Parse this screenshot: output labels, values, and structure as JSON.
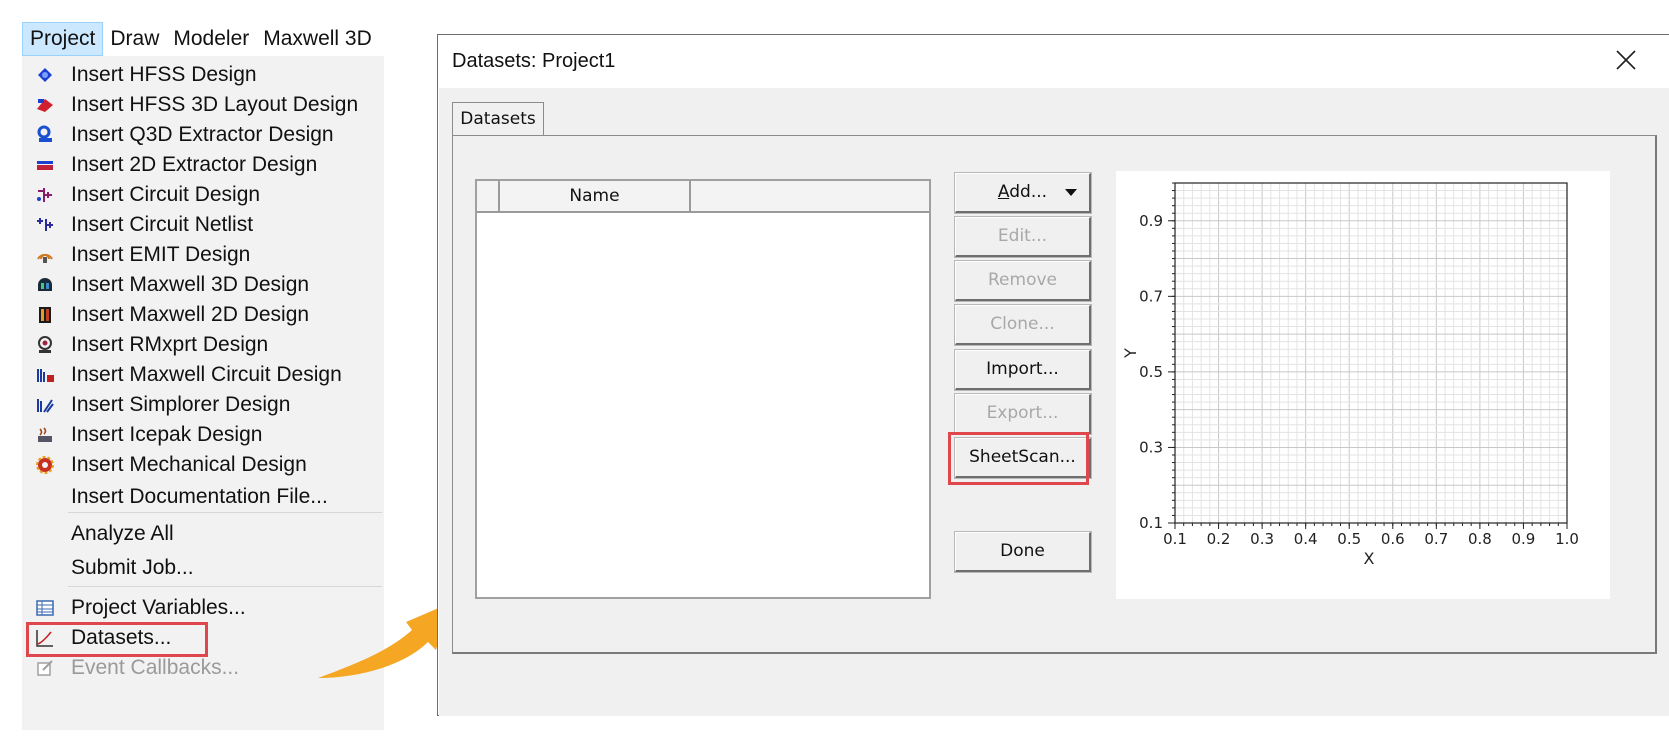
{
  "menubar": {
    "items": [
      "Project",
      "Draw",
      "Modeler",
      "Maxwell 3D"
    ]
  },
  "project_menu": {
    "items": [
      {
        "label": "Insert HFSS Design",
        "icon": "hfss-design-icon",
        "color": "#1d3fd1"
      },
      {
        "label": "Insert HFSS 3D Layout Design",
        "icon": "hfss-3d-layout-icon",
        "color": "#d02030"
      },
      {
        "label": "Insert Q3D Extractor Design",
        "icon": "q3d-extractor-icon",
        "color": "#1a4fd0"
      },
      {
        "label": "Insert 2D Extractor Design",
        "icon": "2d-extractor-icon",
        "color": "#c0203a"
      },
      {
        "label": "Insert Circuit Design",
        "icon": "circuit-design-icon",
        "color": "#8a1a6a"
      },
      {
        "label": "Insert Circuit Netlist",
        "icon": "circuit-netlist-icon",
        "color": "#2a2aa0"
      },
      {
        "label": "Insert EMIT Design",
        "icon": "emit-design-icon",
        "color": "#d07a20"
      },
      {
        "label": "Insert Maxwell 3D Design",
        "icon": "maxwell-3d-icon",
        "color": "#1a5a3a"
      },
      {
        "label": "Insert Maxwell 2D Design",
        "icon": "maxwell-2d-icon",
        "color": "#c04020"
      },
      {
        "label": "Insert RMxprt Design",
        "icon": "rmxprt-icon",
        "color": "#a02040"
      },
      {
        "label": "Insert Maxwell Circuit Design",
        "icon": "maxwell-circuit-icon",
        "color": "#1a3aa0"
      },
      {
        "label": "Insert Simplorer Design",
        "icon": "simplorer-icon",
        "color": "#1a3aa0"
      },
      {
        "label": "Insert Icepak Design",
        "icon": "icepak-icon",
        "color": "#9a4a1a"
      },
      {
        "label": "Insert Mechanical Design",
        "icon": "mechanical-icon",
        "color": "#c83020"
      },
      {
        "label": "Insert Documentation File..."
      },
      {
        "label": "Analyze All"
      },
      {
        "label": "Submit Job..."
      },
      {
        "label": "Project Variables...",
        "icon": "project-variables-icon",
        "color": "#3a6ab0"
      },
      {
        "label": "Datasets...",
        "icon": "datasets-icon",
        "color": "#333333"
      },
      {
        "label": "Event Callbacks...",
        "icon": "event-callbacks-icon",
        "color": "#a0a0a0",
        "disabled": true
      }
    ]
  },
  "dialog": {
    "title": "Datasets: Project1",
    "tab_label": "Datasets",
    "list_column_header": "Name",
    "buttons": {
      "add": "Add...",
      "edit": "Edit...",
      "remove": "Remove",
      "clone": "Clone...",
      "import": "Import...",
      "export": "Export...",
      "sheetscan": "SheetScan...",
      "done": "Done"
    },
    "accelerator_add": "A"
  },
  "chart_data": {
    "type": "line",
    "title": "",
    "xlabel": "X",
    "ylabel": "Y",
    "xlim": [
      0.1,
      1.0
    ],
    "ylim": [
      0.1,
      1.0
    ],
    "x_ticks": [
      "0.1",
      "0.2",
      "0.3",
      "0.4",
      "0.5",
      "0.6",
      "0.7",
      "0.8",
      "0.9",
      "1.0"
    ],
    "y_ticks": [
      "0.1",
      "0.3",
      "0.5",
      "0.7",
      "0.9"
    ],
    "grid": true,
    "series": []
  },
  "colors": {
    "highlight": "#e0474c",
    "arrow": "#f5a623",
    "menu_active_bg": "#cce8ff"
  }
}
